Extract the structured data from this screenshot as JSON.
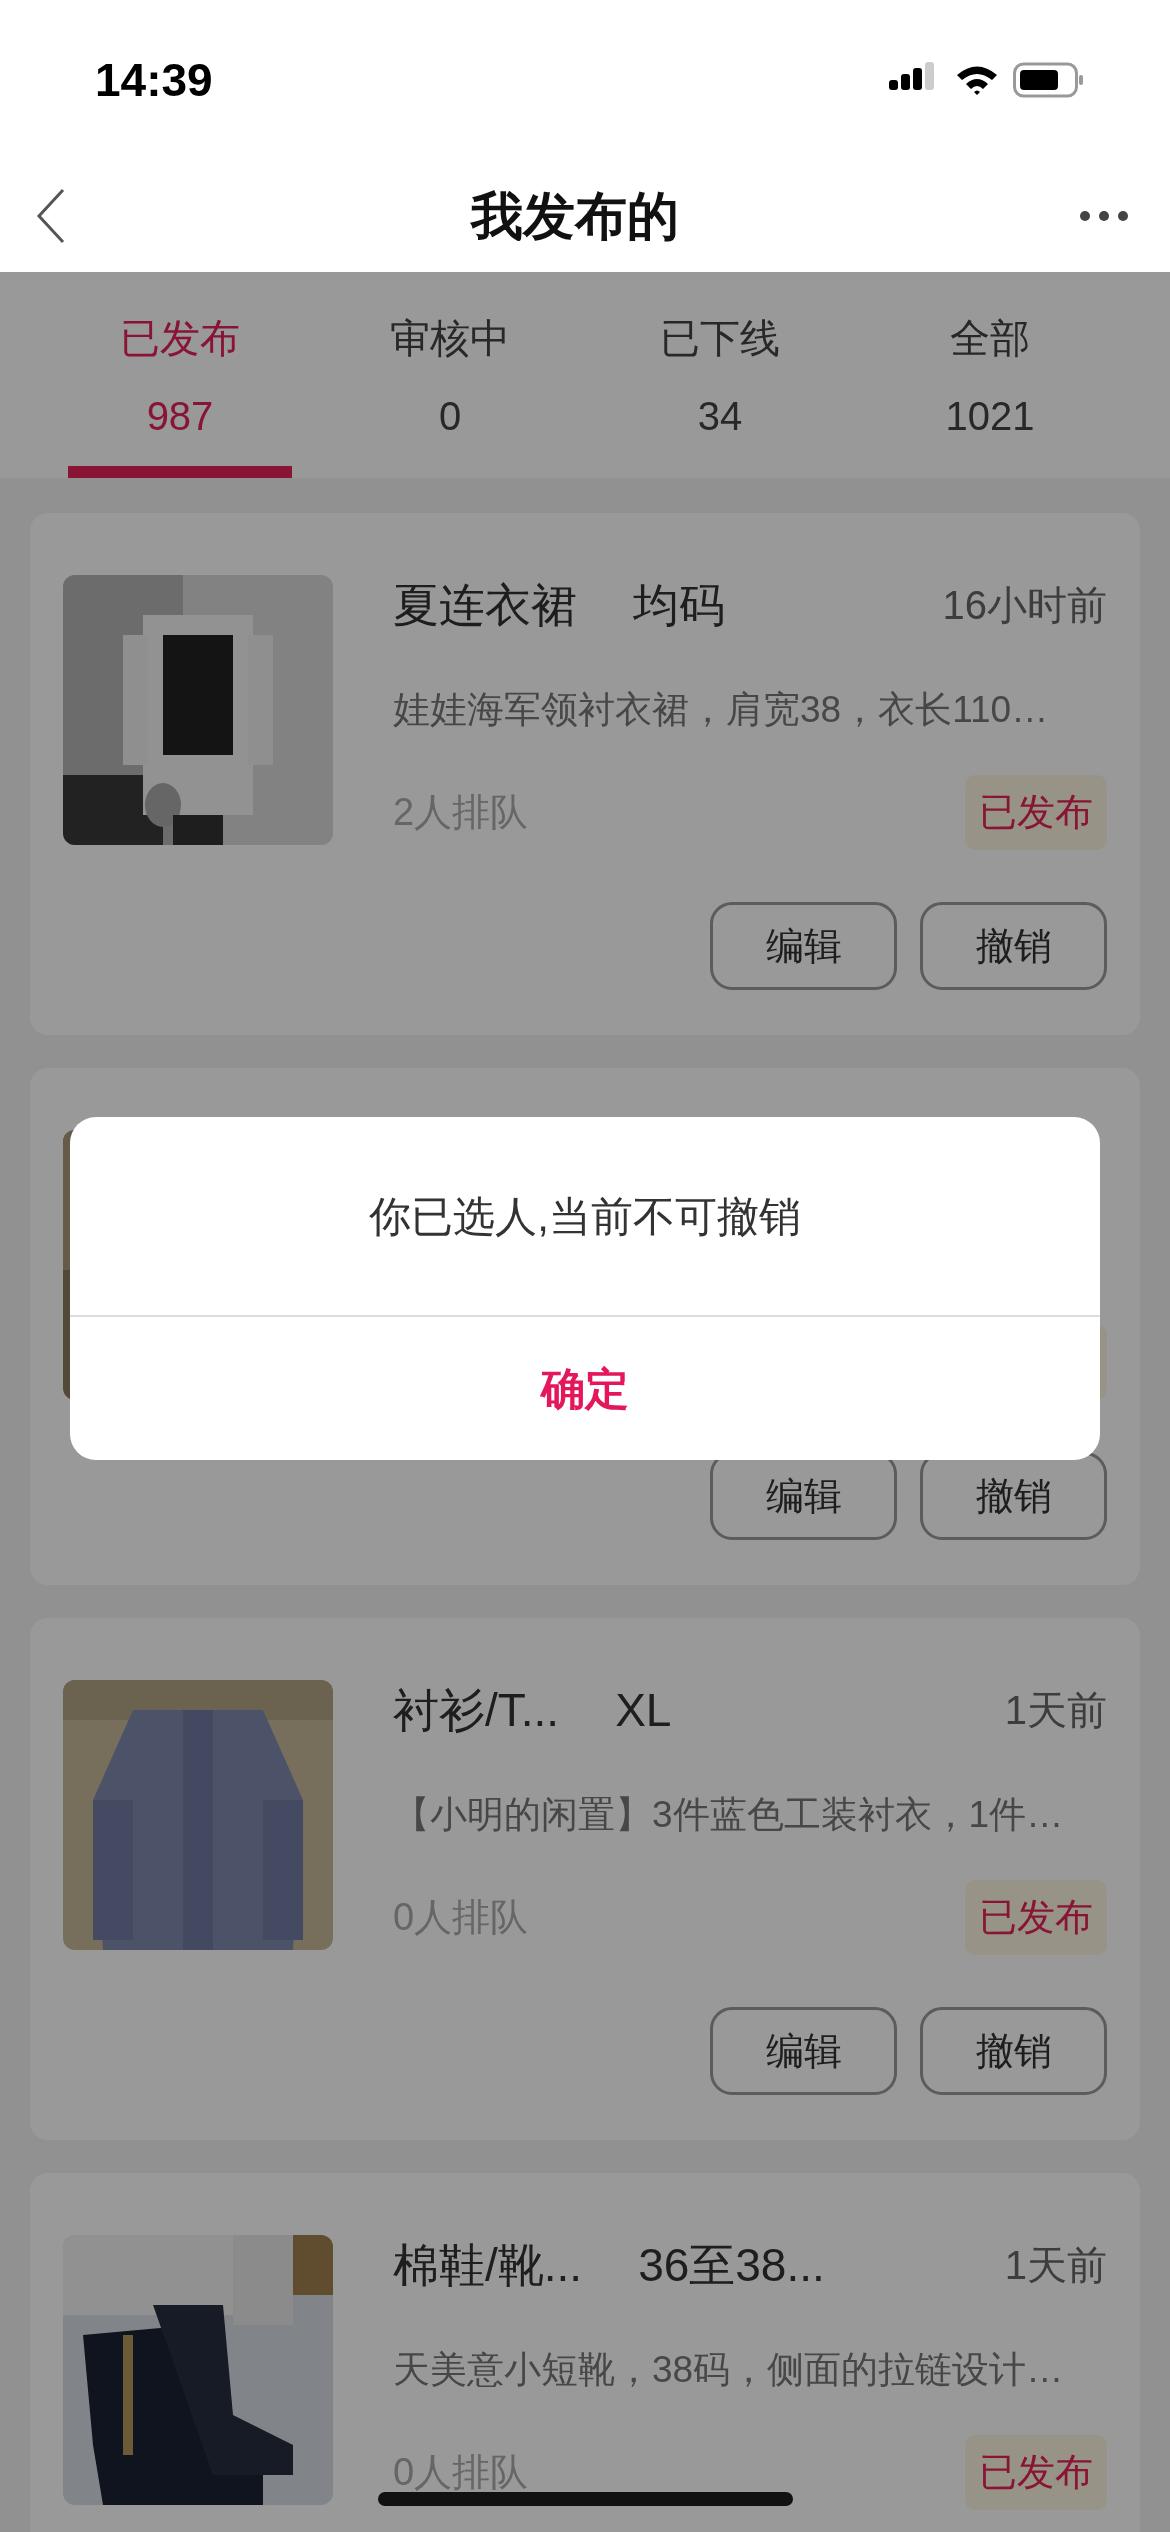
{
  "status_bar": {
    "time": "14:39"
  },
  "nav": {
    "title": "我发布的"
  },
  "tabs": [
    {
      "label": "已发布",
      "count": "987",
      "selected": true
    },
    {
      "label": "审核中",
      "count": "0",
      "selected": false
    },
    {
      "label": "已下线",
      "count": "34",
      "selected": false
    },
    {
      "label": "全部",
      "count": "1021",
      "selected": false
    }
  ],
  "listings": [
    {
      "kind": "full",
      "title": "夏连衣裙",
      "size": "均码",
      "time": "16小时前",
      "description": "娃娃海军领衬衣裙，肩宽38，衣长110…",
      "queue": "2人排队",
      "status": "已发布",
      "buttons": [
        "编辑",
        "撤销"
      ]
    },
    {
      "kind": "covered",
      "buttons": [
        "编辑",
        "撤销"
      ]
    },
    {
      "kind": "full",
      "title": "衬衫/T...",
      "size": "XL",
      "time": "1天前",
      "description": "【小明的闲置】3件蓝色工装衬衣，1件…",
      "queue": "0人排队",
      "status": "已发布",
      "buttons": [
        "编辑",
        "撤销"
      ]
    },
    {
      "kind": "full",
      "title": "棉鞋/靴...",
      "size": "36至38...",
      "time": "1天前",
      "description": "天美意小短靴，38码，侧面的拉链设计…",
      "queue": "0人排队",
      "status": "已发布"
    }
  ],
  "dialog": {
    "message": "你已选人,当前不可撤销",
    "confirm": "确定"
  }
}
